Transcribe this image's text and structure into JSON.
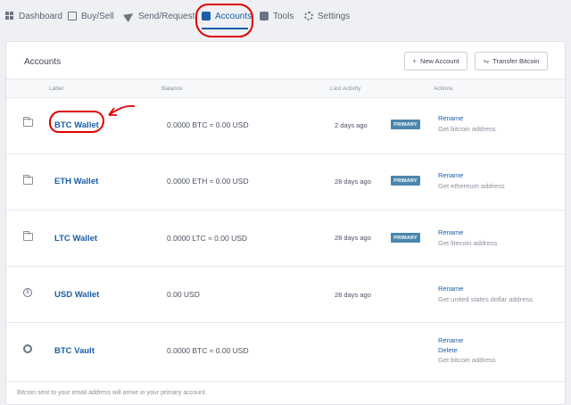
{
  "nav": {
    "dashboard": "Dashboard",
    "buy_sell": "Buy/Sell",
    "send_request": "Send/Request",
    "accounts": "Accounts",
    "tools": "Tools",
    "settings": "Settings"
  },
  "panel": {
    "title": "Accounts",
    "new_account": "New Account",
    "transfer_bitcoin": "Transfer Bitcoin"
  },
  "table": {
    "headers": {
      "label": "Label",
      "balance": "Balance",
      "last_activity": "Last Activity",
      "actions": "Actions"
    },
    "rows": [
      {
        "name": "BTC Wallet",
        "balance": "0.0000 BTC ≈ 0.00 USD",
        "activity": "2 days ago",
        "badge": "PRIMARY",
        "action1": "Rename",
        "action2": "Get bitcoin address"
      },
      {
        "name": "ETH Wallet",
        "balance": "0.0000 ETH ≈ 0.00 USD",
        "activity": "28 days ago",
        "badge": "PRIMARY",
        "action1": "Rename",
        "action2": "Get ethereum address"
      },
      {
        "name": "LTC Wallet",
        "balance": "0.0000 LTC ≈ 0.00 USD",
        "activity": "28 days ago",
        "badge": "PRIMARY",
        "action1": "Rename",
        "action2": "Get litecoin address"
      },
      {
        "name": "USD Wallet",
        "balance": "0.00 USD",
        "activity": "28 days ago",
        "action1": "Rename",
        "action2": "Get united states dollar address"
      },
      {
        "name": "BTC Vault",
        "balance": "0.0000 BTC ≈ 0.00 USD",
        "action1": "Rename",
        "action2": "Delete",
        "action3": "Get bitcoin address"
      }
    ]
  },
  "footer": "Bitcoin sent to your email address will arrive in your primary account.",
  "colors": {
    "accent": "#1a5fa8",
    "badge": "#4a86ad",
    "annotation": "#e00000"
  }
}
